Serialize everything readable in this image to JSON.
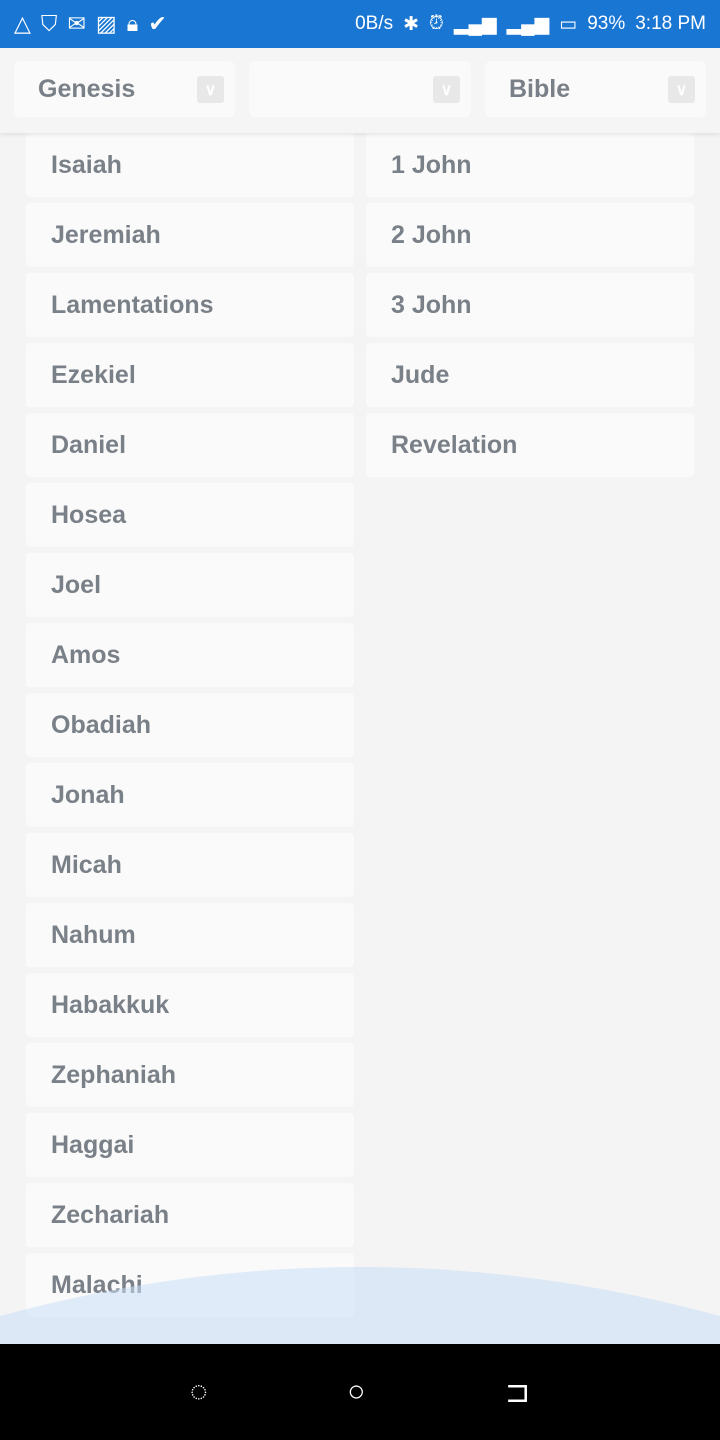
{
  "status_bar": {
    "icons": [
      "drive-icon",
      "shield-icon",
      "gmail-icon",
      "photo-icon",
      "lock-icon",
      "check-icon"
    ],
    "net_speed": "0B/s",
    "battery": "93%",
    "time": "3:18 PM"
  },
  "header": {
    "book_select": "Genesis",
    "chapter_select": "",
    "version_select": "Bible"
  },
  "books_left": [
    "Isaiah",
    "Jeremiah",
    "Lamentations",
    "Ezekiel",
    "Daniel",
    "Hosea",
    "Joel",
    "Amos",
    "Obadiah",
    "Jonah",
    "Micah",
    "Nahum",
    "Habakkuk",
    "Zephaniah",
    "Haggai",
    "Zechariah",
    "Malachi"
  ],
  "books_right": [
    "1 John",
    "2 John",
    "3 John",
    "Jude",
    "Revelation"
  ],
  "colors": {
    "status_bar": "#1976d2",
    "text": "#7a8088"
  }
}
